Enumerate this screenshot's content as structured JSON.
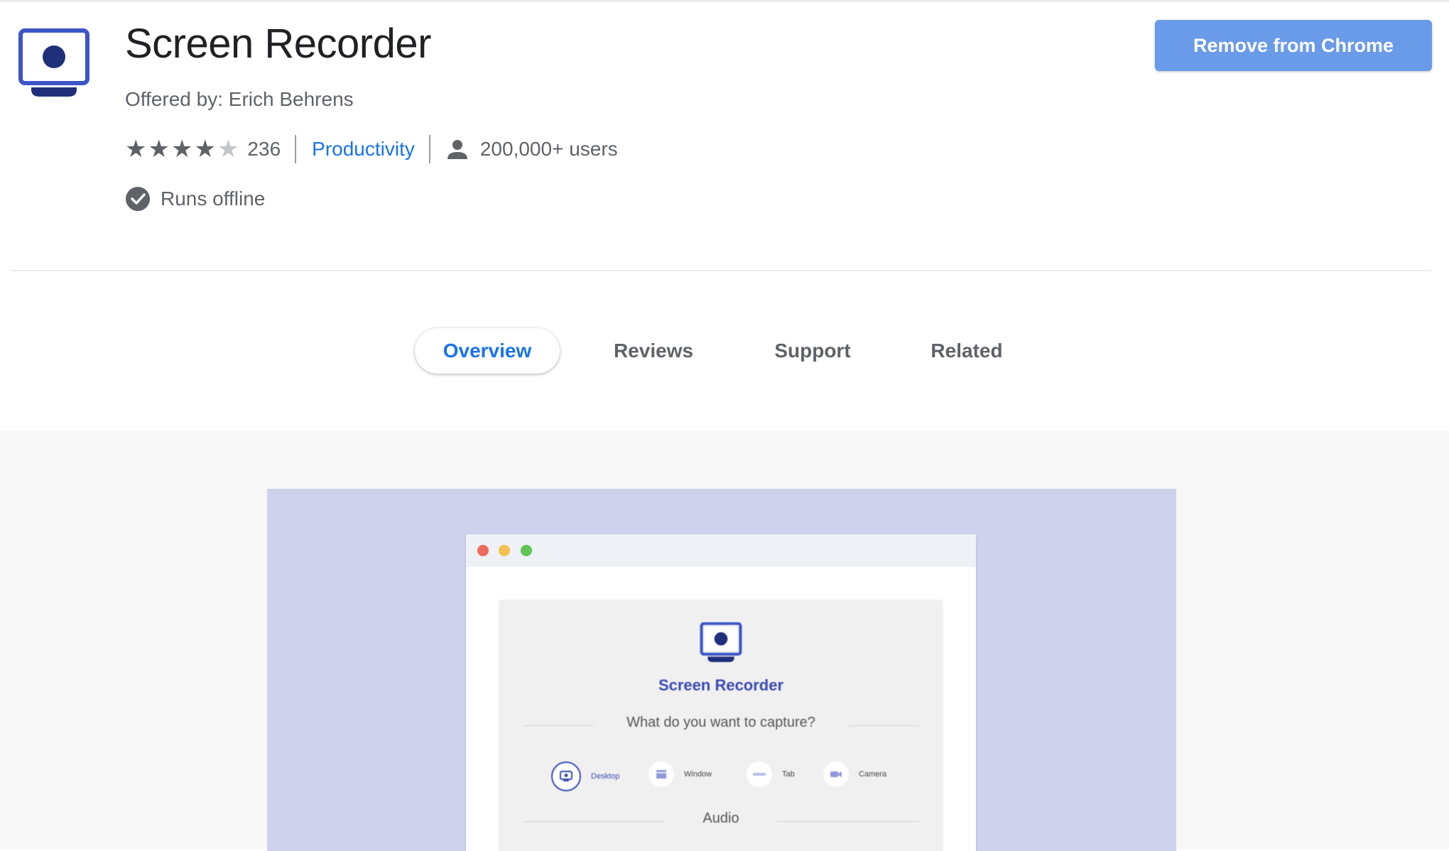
{
  "extension": {
    "title": "Screen Recorder",
    "offered_by": "Offered by: Erich Behrens",
    "rating": 4,
    "rating_max": 5,
    "rating_count": "236",
    "category": "Productivity",
    "users": "200,000+ users",
    "offline_text": "Runs offline",
    "remove_label": "Remove from Chrome"
  },
  "tabs": [
    {
      "label": "Overview",
      "active": true
    },
    {
      "label": "Reviews",
      "active": false
    },
    {
      "label": "Support",
      "active": false
    },
    {
      "label": "Related",
      "active": false
    }
  ],
  "icons": {
    "extension_logo": "monitor-record-icon",
    "users": "person-icon",
    "offline": "check-circle-icon"
  },
  "colors": {
    "accent": "#1a73e8",
    "button": "#6a9be8",
    "logo_primary": "#3d55c8",
    "logo_dark": "#1f2f7a",
    "screenshot_bg": "#cfd2ec"
  },
  "screenshot_preview": {
    "app_title": "Screen Recorder",
    "question": "What do you want to capture?",
    "options": [
      {
        "label": "Desktop",
        "selected": true
      },
      {
        "label": "Window",
        "selected": false
      },
      {
        "label": "Tab",
        "selected": false
      },
      {
        "label": "Camera",
        "selected": false
      }
    ],
    "audio_label": "Audio"
  }
}
